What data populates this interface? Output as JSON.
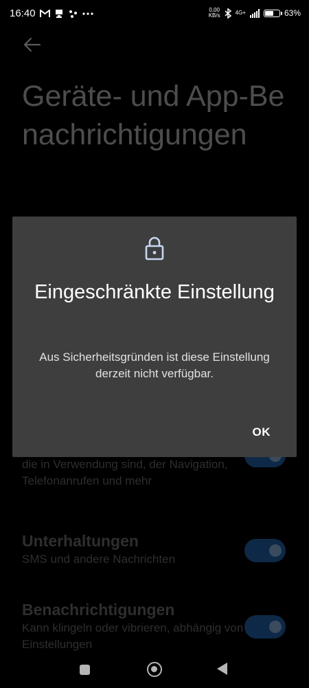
{
  "status_bar": {
    "time": "16:40",
    "net_speed_value": "0,00",
    "net_speed_unit": "KB/s",
    "network_type": "4G+",
    "battery_percent": "63%",
    "battery_level": 0.63,
    "notification_icons": [
      "gmail-icon",
      "cast-icon",
      "dots-icon",
      "more-icon"
    ]
  },
  "page": {
    "title": "Geräte- und App-Benachrichtigungen"
  },
  "settings": [
    {
      "title": "",
      "desc": "die in Verwendung sind, der Navigation, Telefonanrufen und mehr",
      "enabled": true
    },
    {
      "title": "Unterhaltungen",
      "desc": "SMS und andere Nachrichten",
      "enabled": true
    },
    {
      "title": "Benachrichtigungen",
      "desc": "Kann klingeln oder vibrieren, abhängig von den Einstellungen",
      "enabled": true
    }
  ],
  "dialog": {
    "icon": "lock-icon",
    "title": "Eingeschränkte Einstellung",
    "body": "Aus Sicherheitsgründen ist diese Einstellung derzeit nicht verfügbar.",
    "ok_label": "OK"
  },
  "nav_bar": {
    "buttons": [
      "recents-button",
      "home-button",
      "back-button"
    ]
  },
  "colors": {
    "background": "#000000",
    "dialog": "#3e3e3e",
    "toggle_on": "#0e2947"
  }
}
